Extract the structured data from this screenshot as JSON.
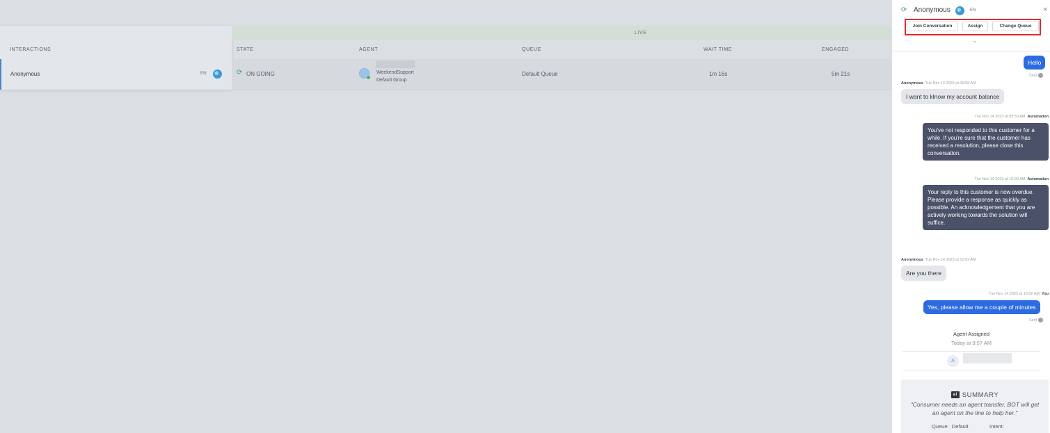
{
  "table": {
    "band_label": "LIVE",
    "headers": {
      "interactions": "INTERACTIONS",
      "state": "STATE",
      "agent": "AGENT",
      "queue": "QUEUE",
      "wait_time": "WAIT TIME",
      "engaged": "ENGAGED"
    },
    "row": {
      "name": "Anonymous",
      "lang": "EN",
      "state": "ON GOING",
      "agent_group": "WeekendSupport",
      "agent_subgroup": "Default Group",
      "queue": "Default Queue",
      "wait_time": "1m 16s",
      "engaged": "5m 21s"
    }
  },
  "panel": {
    "title": "Anonymous",
    "lang": "EN",
    "close": "×",
    "chevron": "⌄",
    "actions": {
      "join": "Join Conversation",
      "assign": "Assign",
      "change_queue": "Change Queue"
    },
    "messages": {
      "m1": {
        "text": "Hello",
        "status": "Sent"
      },
      "m2": {
        "author": "Anonymous",
        "time": "Tue Nov 14 2023 at 09:58 AM",
        "text": "I want to klnow my account balance"
      },
      "m3": {
        "time": "Tue Nov 14 2023 at 09:59 AM",
        "author": "Automation",
        "text": "You've not responded to this customer for a while. If you're sure that the customer has received a resolution, please close this conversation."
      },
      "m4": {
        "time": "Tue Nov 14 2023 at 10:00 AM",
        "author": "Automation",
        "text": "Your reply to this customer is now overdue. Please provide a response as quickly as possible. An acknowledgement that you are actively working towards the solution will suffice."
      },
      "m5": {
        "author": "Anonymous",
        "time": "Tue Nov 14 2023 at 10:02 AM",
        "text": "Are you there"
      },
      "m6": {
        "time": "Tue Nov 14 2023 at 10:02 AM",
        "author": "You",
        "text": "Yes, please allow me a couple of minutes",
        "status": "Sent"
      }
    },
    "assignment": {
      "title": "Agent Assigned",
      "time": "Today at 9:57 AM",
      "avatar_letter": "A"
    },
    "summary": {
      "icon": "ai",
      "title": "SUMMARY",
      "quote": "\"Consumer needs an agent transfer. BOT will get an agent on the line to help her.\"",
      "queue_label": "Queue:",
      "queue_value": "Default",
      "intent_label": "Intent:"
    }
  },
  "colors": {
    "accent_blue": "#2d6be0",
    "automation_bubble": "#4b5168",
    "highlight_red": "#e02b2b",
    "live_band": "#d3ded6"
  }
}
